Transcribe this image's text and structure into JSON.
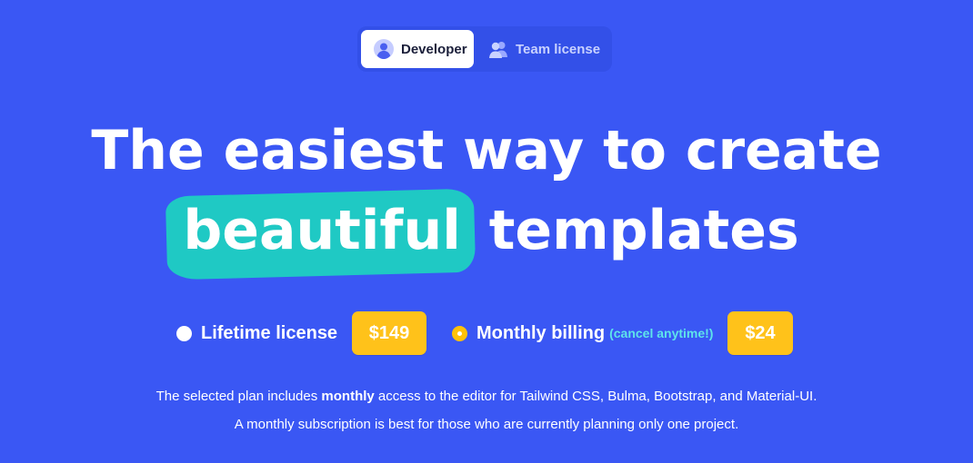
{
  "tabs": [
    {
      "label": "Developer",
      "icon": "user-icon",
      "active": true
    },
    {
      "label": "Team license",
      "icon": "users-icon",
      "active": false
    }
  ],
  "headline": {
    "line1": "The easiest way to create",
    "highlight": "beautiful",
    "line2_rest": "templates"
  },
  "billing": {
    "lifetime": {
      "label": "Lifetime license",
      "price": "$149",
      "selected": false
    },
    "monthly": {
      "label": "Monthly billing",
      "note": "(cancel anytime!)",
      "price": "$24",
      "selected": true
    }
  },
  "description": {
    "line1_before": "The selected plan includes ",
    "line1_bold": "monthly",
    "line1_after": " access to the editor for Tailwind CSS, Bulma, Bootstrap, and Material-UI.",
    "line2": "A monthly subscription is best for those who are currently planning only one project."
  },
  "colors": {
    "background": "#3a57f4",
    "highlight": "#1fc9c4",
    "price_badge": "#ffc21a",
    "note_text": "#5ee4ea"
  }
}
